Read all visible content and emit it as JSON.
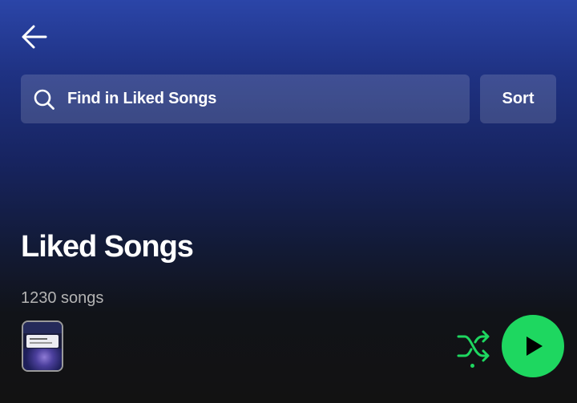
{
  "header": {
    "back_icon": "arrow-left-icon"
  },
  "search": {
    "icon": "search-icon",
    "placeholder": "Find in Liked Songs"
  },
  "sort": {
    "label": "Sort"
  },
  "playlist": {
    "title": "Liked Songs",
    "song_count": "1230 songs"
  },
  "controls": {
    "shuffle_icon": "shuffle-icon",
    "shuffle_active": true,
    "play_icon": "play-icon"
  },
  "colors": {
    "accent_green": "#1ed760",
    "gradient_top": "#2b45a8",
    "background": "#121212",
    "muted_text": "#b3b3b3"
  }
}
